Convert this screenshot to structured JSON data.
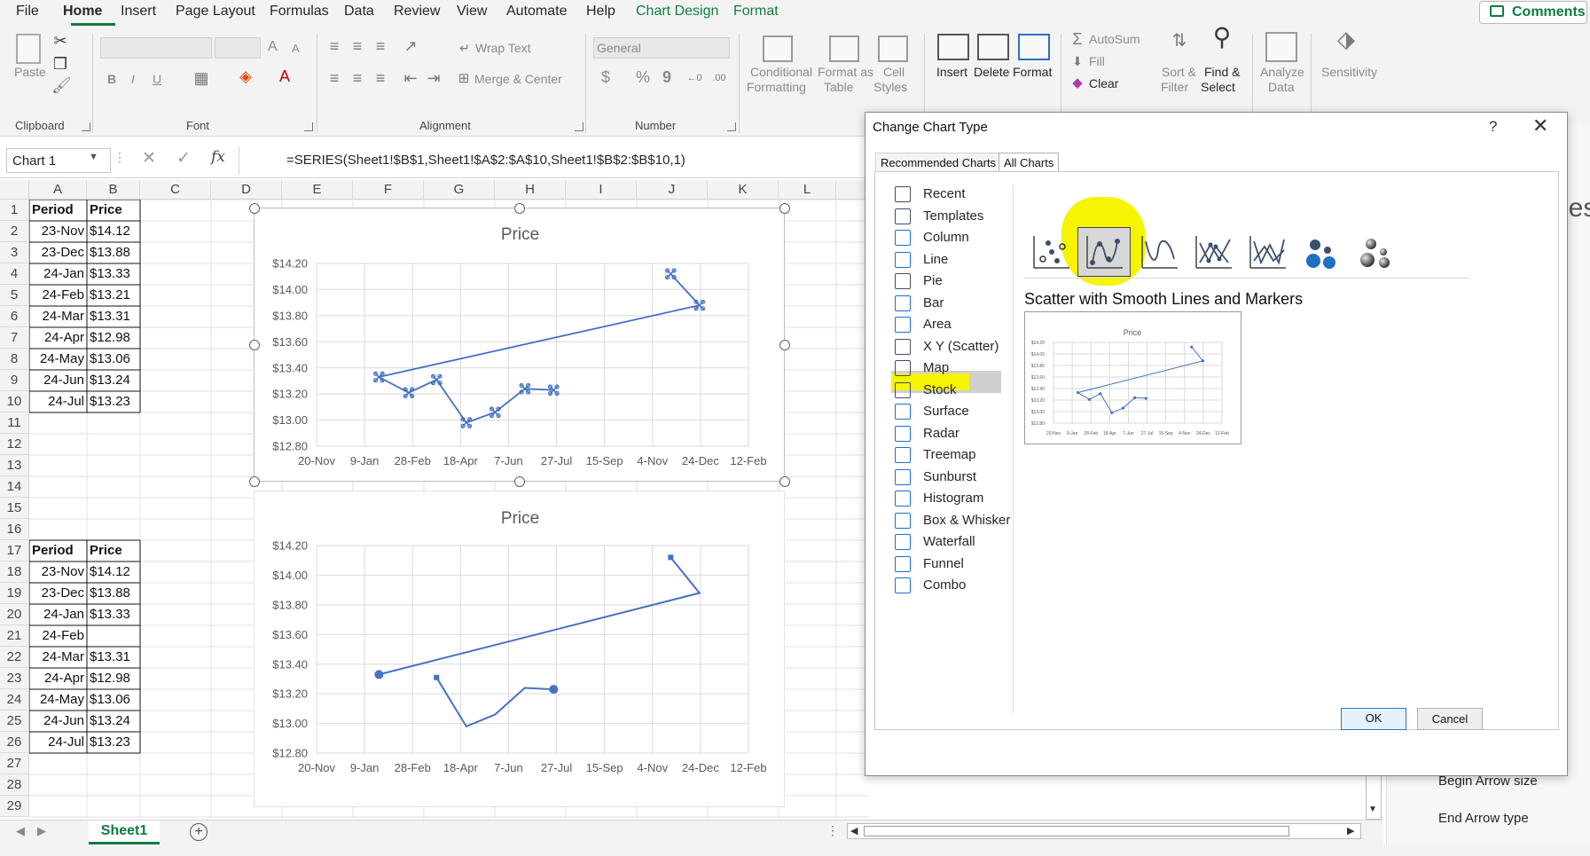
{
  "menu": {
    "items": [
      "File",
      "Home",
      "Insert",
      "Page Layout",
      "Formulas",
      "Data",
      "Review",
      "View",
      "Automate",
      "Help",
      "Chart Design",
      "Format"
    ],
    "comments_label": "Comments"
  },
  "ribbon": {
    "clipboard": {
      "paste": "Paste",
      "label": "Clipboard"
    },
    "font": {
      "label": "Font",
      "bold": "B",
      "italic": "I",
      "underline": "U",
      "grow": "A",
      "shrink": "A"
    },
    "alignment": {
      "wrap_text": "Wrap Text",
      "merge_center": "Merge & Center",
      "label": "Alignment"
    },
    "number": {
      "format": "General",
      "currency": "$",
      "percent": "%",
      "comma": "9",
      "label": "Number"
    },
    "styles": {
      "conditional_1": "Conditional",
      "conditional_2": "Formatting",
      "format_table_1": "Format as",
      "format_table_2": "Table",
      "cell_styles_1": "Cell",
      "cell_styles_2": "Styles"
    },
    "cells": {
      "insert": "Insert",
      "delete": "Delete",
      "format": "Format"
    },
    "editing": {
      "autosum": "AutoSum",
      "fill": "Fill",
      "clear": "Clear",
      "sort_1": "Sort &",
      "sort_2": "Filter",
      "find_1": "Find &",
      "find_2": "Select"
    },
    "analysis": {
      "analyze_1": "Analyze",
      "analyze_2": "Data"
    },
    "sensitivity": {
      "label": "Sensitivity"
    }
  },
  "formula_bar": {
    "name_box": "Chart 1",
    "formula": "=SERIES(Sheet1!$B$1,Sheet1!$A$2:$A$10,Sheet1!$B$2:$B$10,1)",
    "fx": "fx"
  },
  "grid": {
    "columns": [
      "A",
      "B",
      "C",
      "D",
      "E",
      "F",
      "G",
      "H",
      "I",
      "J",
      "K",
      "L"
    ],
    "rows": [
      "1",
      "2",
      "3",
      "4",
      "5",
      "6",
      "7",
      "8",
      "9",
      "10",
      "11",
      "12",
      "13",
      "14",
      "15",
      "16",
      "17",
      "18",
      "19",
      "20",
      "21",
      "22",
      "23",
      "24",
      "25",
      "26",
      "27",
      "28",
      "29"
    ],
    "table1": {
      "headers": [
        "Period",
        "Price"
      ],
      "rows": [
        [
          "23-Nov",
          "$14.12"
        ],
        [
          "23-Dec",
          "$13.88"
        ],
        [
          "24-Jan",
          "$13.33"
        ],
        [
          "24-Feb",
          "$13.21"
        ],
        [
          "24-Mar",
          "$13.31"
        ],
        [
          "24-Apr",
          "$12.98"
        ],
        [
          "24-May",
          "$13.06"
        ],
        [
          "24-Jun",
          "$13.24"
        ],
        [
          "24-Jul",
          "$13.23"
        ]
      ]
    },
    "table2": {
      "headers": [
        "Period",
        "Price"
      ],
      "rows": [
        [
          "23-Nov",
          "$14.12"
        ],
        [
          "23-Dec",
          "$13.88"
        ],
        [
          "24-Jan",
          "$13.33"
        ],
        [
          "24-Feb",
          ""
        ],
        [
          "24-Mar",
          "$13.31"
        ],
        [
          "24-Apr",
          "$12.98"
        ],
        [
          "24-May",
          "$13.06"
        ],
        [
          "24-Jun",
          "$13.24"
        ],
        [
          "24-Jul",
          "$13.23"
        ]
      ]
    }
  },
  "chart_data": [
    {
      "type": "line",
      "title": "Price",
      "x_ticks": [
        "20-Nov",
        "9-Jan",
        "28-Feb",
        "18-Apr",
        "7-Jun",
        "27-Jul",
        "15-Sep",
        "4-Nov",
        "24-Dec",
        "12-Feb"
      ],
      "y_ticks": [
        "$12.80",
        "$13.00",
        "$13.20",
        "$13.40",
        "$13.60",
        "$13.80",
        "$14.00",
        "$14.20"
      ],
      "ylim": [
        12.8,
        14.2
      ],
      "xlim": [
        "2023-11-20",
        "2025-02-12"
      ],
      "grid": true,
      "series": [
        {
          "x": [
            "2024-11-23",
            "2024-12-23",
            "2024-01-24",
            "2024-02-24",
            "2024-03-24",
            "2024-04-24",
            "2024-05-24",
            "2024-06-24",
            "2024-07-24"
          ],
          "y": [
            14.12,
            13.88,
            13.33,
            13.21,
            13.31,
            12.98,
            13.06,
            13.24,
            13.23
          ]
        }
      ]
    },
    {
      "type": "line",
      "title": "Price",
      "x_ticks": [
        "20-Nov",
        "9-Jan",
        "28-Feb",
        "18-Apr",
        "7-Jun",
        "27-Jul",
        "15-Sep",
        "4-Nov",
        "24-Dec",
        "12-Feb"
      ],
      "y_ticks": [
        "$12.80",
        "$13.00",
        "$13.20",
        "$13.40",
        "$13.60",
        "$13.80",
        "$14.00",
        "$14.20"
      ],
      "ylim": [
        12.8,
        14.2
      ],
      "xlim": [
        "2023-11-20",
        "2025-02-12"
      ],
      "grid": true,
      "series": [
        {
          "x": [
            "2024-11-23",
            "2024-12-23",
            "2024-01-24",
            "2024-03-24",
            "2024-04-24",
            "2024-05-24",
            "2024-06-24",
            "2024-07-24"
          ],
          "y": [
            14.12,
            13.88,
            13.33,
            13.31,
            12.98,
            13.06,
            13.24,
            13.23
          ]
        }
      ]
    }
  ],
  "dialog": {
    "title": "Change Chart Type",
    "help": "?",
    "close": "✕",
    "tabs": [
      "Recommended Charts",
      "All Charts"
    ],
    "categories": [
      "Recent",
      "Templates",
      "Column",
      "Line",
      "Pie",
      "Bar",
      "Area",
      "X Y (Scatter)",
      "Map",
      "Stock",
      "Surface",
      "Radar",
      "Treemap",
      "Sunburst",
      "Histogram",
      "Box & Whisker",
      "Waterfall",
      "Funnel",
      "Combo"
    ],
    "selected_category": "X Y (Scatter)",
    "subtype_name": "Scatter with Smooth Lines and Markers",
    "preview_title": "Price",
    "ok": "OK",
    "cancel": "Cancel"
  },
  "sheet_tabs": {
    "active": "Sheet1",
    "add": "+"
  },
  "right_panel": {
    "begin_arrow_size": "Begin Arrow size",
    "end_arrow_type": "End Arrow type",
    "partial_title": "ies"
  },
  "colors": {
    "accent": "#107c41",
    "series": "#4472c4",
    "highlight": "#f7f400"
  }
}
